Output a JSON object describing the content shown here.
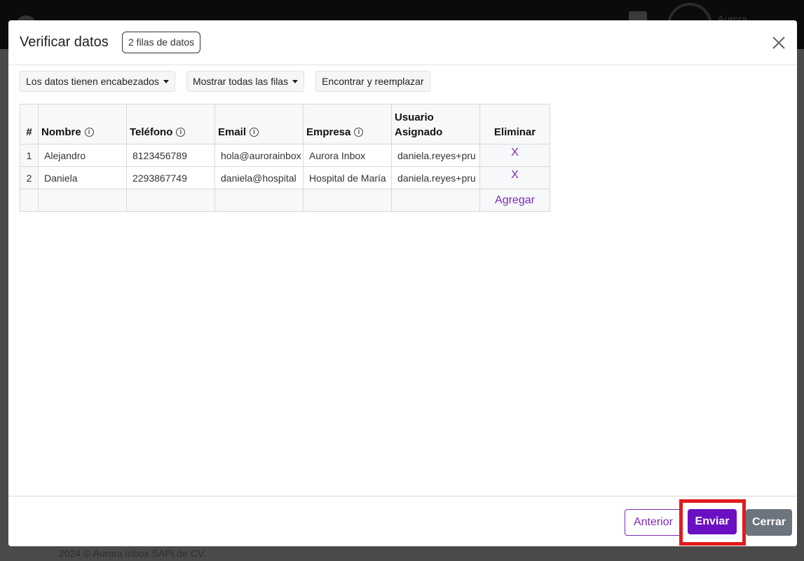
{
  "background": {
    "user_name": "Aurora",
    "footer_text": "2024 © Aurora Inbox SAPI de CV."
  },
  "modal": {
    "title": "Verificar datos",
    "rows_badge": "2 filas de datos",
    "close_icon": "close-icon"
  },
  "toolbar": {
    "headers_dropdown": "Los datos tienen encabezados",
    "rows_dropdown": "Mostrar todas las filas",
    "find_replace": "Encontrar y reemplazar"
  },
  "table": {
    "headers": {
      "index": "#",
      "nombre": "Nombre",
      "telefono": "Teléfono",
      "email": "Email",
      "empresa": "Empresa",
      "usuario_line1": "Usuario",
      "usuario_line2": "Asignado",
      "eliminar": "Eliminar"
    },
    "rows": [
      {
        "index": "1",
        "nombre": "Alejandro",
        "telefono": "8123456789",
        "email": "hola@aurorainbox",
        "empresa": "Aurora Inbox",
        "usuario": "daniela.reyes+pru",
        "delete": "X"
      },
      {
        "index": "2",
        "nombre": "Daniela",
        "telefono": "2293867749",
        "email": "daniela@hospital",
        "empresa": "Hospital de María",
        "usuario": "daniela.reyes+pru",
        "delete": "X"
      }
    ],
    "add_label": "Agregar"
  },
  "footer": {
    "prev_label": "Anterior",
    "send_label": "Enviar",
    "close_label": "Cerrar"
  },
  "colors": {
    "accent": "#6a0fc2",
    "link": "#7a2bb8",
    "highlight": "#e01b1b",
    "secondary": "#6c757d"
  }
}
